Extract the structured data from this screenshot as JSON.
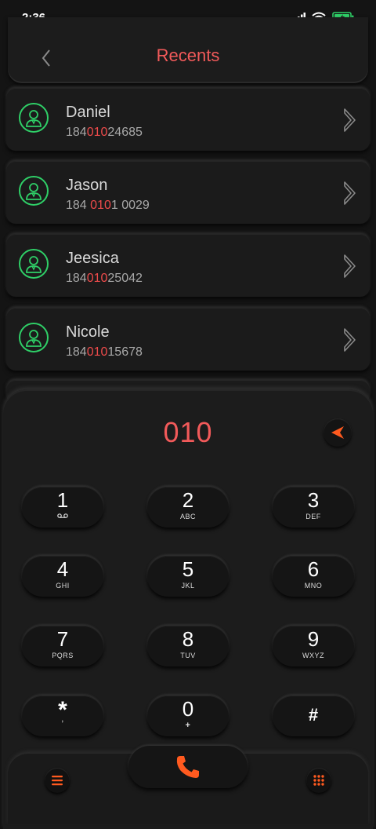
{
  "status": {
    "time": "2:36"
  },
  "header": {
    "title": "Recents"
  },
  "contacts": [
    {
      "name": "Daniel",
      "pre": "184",
      "match": "010",
      "post": "24685"
    },
    {
      "name": "Jason",
      "pre": "184 ",
      "match": "010",
      "post": "1 0029"
    },
    {
      "name": "Jeesica",
      "pre": "184",
      "match": "010",
      "post": "25042"
    },
    {
      "name": "Nicole",
      "pre": "184",
      "match": "010",
      "post": "15678"
    }
  ],
  "dialer": {
    "input": "010",
    "keys": [
      {
        "digit": "1",
        "letters": ""
      },
      {
        "digit": "2",
        "letters": "ABC"
      },
      {
        "digit": "3",
        "letters": "DEF"
      },
      {
        "digit": "4",
        "letters": "GHI"
      },
      {
        "digit": "5",
        "letters": "JKL"
      },
      {
        "digit": "6",
        "letters": "MNO"
      },
      {
        "digit": "7",
        "letters": "PQRS"
      },
      {
        "digit": "8",
        "letters": "TUV"
      },
      {
        "digit": "9",
        "letters": "WXYZ"
      },
      {
        "digit": "*",
        "letters": ","
      },
      {
        "digit": "0",
        "letters": "+"
      },
      {
        "digit": "#",
        "letters": ""
      }
    ]
  },
  "icons": {
    "back": "chevron-left-icon",
    "avatar": "user-icon",
    "chevron": "chevron-right-icon",
    "backspace": "send-arrow-icon",
    "voicemail": "voicemail-icon",
    "call": "phone-icon",
    "menu": "menu-icon",
    "keypad": "keypad-icon"
  },
  "colors": {
    "accent": "#f25a5a",
    "avatar_ring": "#2fcf67",
    "battery": "#2fcf67",
    "call": "#ff5a1f"
  }
}
